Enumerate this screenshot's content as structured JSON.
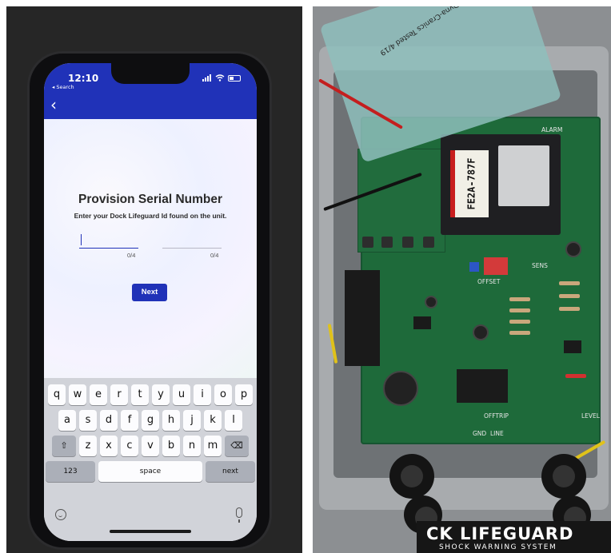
{
  "phone": {
    "status": {
      "time": "12:10",
      "back_app": "◂ Search"
    },
    "nav": {
      "back_glyph": "‹"
    },
    "screen": {
      "title": "Provision Serial Number",
      "subtitle": "Enter your Dock Lifeguard Id found on the unit.",
      "field1_counter": "0/4",
      "field2_counter": "0/4",
      "next_button": "Next"
    },
    "keyboard": {
      "row1": [
        "q",
        "w",
        "e",
        "r",
        "t",
        "y",
        "u",
        "i",
        "o",
        "p"
      ],
      "row2": [
        "a",
        "s",
        "d",
        "f",
        "g",
        "h",
        "j",
        "k",
        "l"
      ],
      "row3": [
        "z",
        "x",
        "c",
        "v",
        "b",
        "n",
        "m"
      ],
      "shift_glyph": "⇧",
      "delete_glyph": "⌫",
      "numbers_key": "123",
      "space_key": "space",
      "return_key": "next"
    }
  },
  "device": {
    "serial_label": "FE2A-787F",
    "ribbon_label": "Dyna-Cranics Tested 4/19",
    "brand_main": "CK LIFEGUARD",
    "brand_sub": "SHOCK WARNING SYSTEM",
    "pcb_labels": {
      "alarm": "ALARM",
      "offset": "OFFSET",
      "sens": "SENS",
      "gnd": "GND",
      "line": "LINE",
      "offtrip": "OFFTRIP",
      "level": "LEVEL"
    }
  },
  "colors": {
    "app_bar": "#2032b8",
    "pcb_green": "#1e6a3a",
    "serial_stripe": "#c81e1e"
  }
}
